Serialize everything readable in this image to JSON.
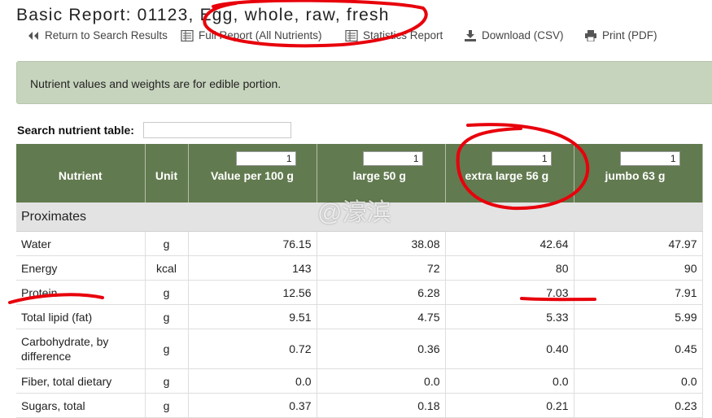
{
  "page": {
    "title": "Basic Report:  01123, Egg, whole, raw, fresh"
  },
  "toolbar": {
    "items": [
      {
        "label": "Return to Search Results",
        "icon": "double-left-arrow-icon"
      },
      {
        "label": "Full Report (All Nutrients)",
        "icon": "report-icon"
      },
      {
        "label": "Statistics Report",
        "icon": "report-icon"
      },
      {
        "label": "Download (CSV)",
        "icon": "download-icon"
      },
      {
        "label": "Print (PDF)",
        "icon": "printer-icon"
      }
    ]
  },
  "info_banner": "Nutrient values and weights are for edible portion.",
  "search": {
    "label": "Search nutrient table:",
    "value": ""
  },
  "table": {
    "headers": {
      "nutrient": "Nutrient",
      "unit": "Unit",
      "measures": [
        {
          "label": "Value per 100 g",
          "qty": "1"
        },
        {
          "label": "large 50 g",
          "qty": "1"
        },
        {
          "label": "extra large 56 g",
          "qty": "1"
        },
        {
          "label": "jumbo 63 g",
          "qty": "1"
        }
      ]
    },
    "group": "Proximates",
    "rows": [
      {
        "name": "Water",
        "unit": "g",
        "values": [
          "76.15",
          "38.08",
          "42.64",
          "47.97"
        ]
      },
      {
        "name": "Energy",
        "unit": "kcal",
        "values": [
          "143",
          "72",
          "80",
          "90"
        ]
      },
      {
        "name": "Protein",
        "unit": "g",
        "values": [
          "12.56",
          "6.28",
          "7.03",
          "7.91"
        ]
      },
      {
        "name": "Total lipid (fat)",
        "unit": "g",
        "values": [
          "9.51",
          "4.75",
          "5.33",
          "5.99"
        ]
      },
      {
        "name": "Carbohydrate, by difference",
        "unit": "g",
        "values": [
          "0.72",
          "0.36",
          "0.40",
          "0.45"
        ]
      },
      {
        "name": "Fiber, total dietary",
        "unit": "g",
        "values": [
          "0.0",
          "0.0",
          "0.0",
          "0.0"
        ]
      },
      {
        "name": "Sugars, total",
        "unit": "g",
        "values": [
          "0.37",
          "0.18",
          "0.21",
          "0.23"
        ]
      }
    ]
  },
  "watermark": "@濠滨",
  "annotation_color": "#e8000b",
  "header_color": "#627a4f"
}
